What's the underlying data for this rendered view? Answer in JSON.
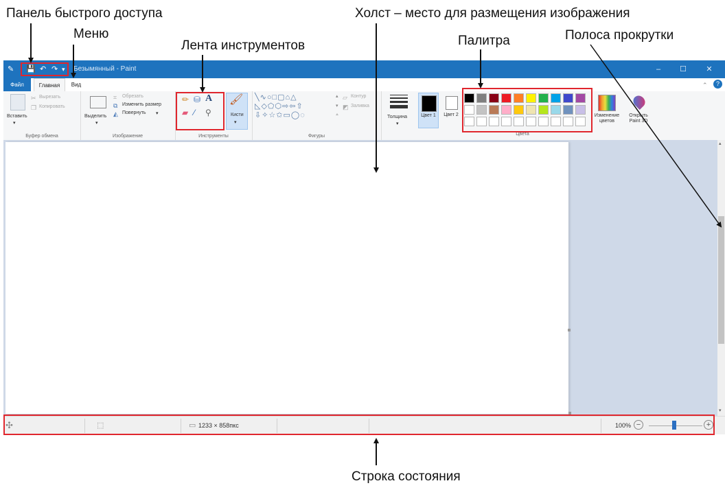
{
  "annotations": {
    "quick_access": "Панель быстрого доступа",
    "menu": "Меню",
    "canvas": "Холст – место для размещения изображения",
    "ribbon": "Лента инструментов",
    "palette": "Палитра",
    "scrollbar": "Полоса прокрутки",
    "status_bar": "Строка состояния"
  },
  "window": {
    "title": "Безымянный - Paint",
    "minimize": "–",
    "maximize": "☐",
    "close": "✕"
  },
  "quick_access": {
    "save_icon": "💾",
    "undo_icon": "↶",
    "redo_icon": "↷",
    "dropdown_icon": "▾"
  },
  "menu": {
    "file": "Файл",
    "home": "Главная",
    "view": "Вид"
  },
  "ribbon": {
    "clipboard": {
      "label": "Буфер обмена",
      "paste": "Вставить",
      "cut": "Вырезать",
      "copy": "Копировать"
    },
    "image": {
      "label": "Изображение",
      "select": "Выделить",
      "crop": "Обрезать",
      "resize": "Изменить размер",
      "rotate": "Повернуть"
    },
    "tools": {
      "label": "Инструменты",
      "brushes": "Кисти"
    },
    "shapes": {
      "label": "Фигуры",
      "outline": "Контур",
      "fill": "Заливка"
    },
    "size": "Толщина",
    "color1": "Цвет 1",
    "color2": "Цвет 2",
    "colors_label": "Цвета",
    "edit_colors": "Изменение цветов",
    "open_paint3d": "Открыть Paint 3D"
  },
  "palette": {
    "row1": [
      "#000000",
      "#7f7f7f",
      "#880015",
      "#ed1c24",
      "#ff7f27",
      "#fff200",
      "#22b14c",
      "#00a2e8",
      "#3f48cc",
      "#a349a4"
    ],
    "row2": [
      "#ffffff",
      "#c3c3c3",
      "#b97a57",
      "#ffaec9",
      "#ffc90e",
      "#efe4b0",
      "#b5e61d",
      "#99d9ea",
      "#7092be",
      "#c8bfe7"
    ],
    "row3": [
      "#ffffff",
      "#ffffff",
      "#ffffff",
      "#ffffff",
      "#ffffff",
      "#ffffff",
      "#ffffff",
      "#ffffff",
      "#ffffff",
      "#ffffff"
    ]
  },
  "colors": {
    "titlebar": "#1e73be",
    "color1": "#000000",
    "color2": "#ffffff",
    "annotation_box": "#e0262d",
    "canvas_bg": "#cfd9e8"
  },
  "status": {
    "size": "1233 × 858пкс",
    "zoom": "100%",
    "zoom_level": 1.0
  }
}
